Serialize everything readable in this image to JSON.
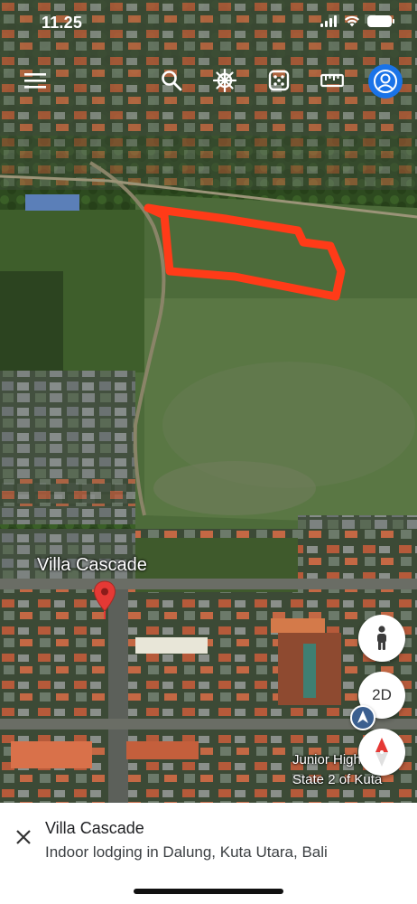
{
  "status_bar": {
    "time": "11.25"
  },
  "toolbar": {
    "menu": "menu-icon",
    "search": "search-icon",
    "voyager": "ship-wheel-icon",
    "random": "dice-icon",
    "measure": "ruler-icon",
    "profile": "profile-icon"
  },
  "map": {
    "place_label": "Villa Cascade",
    "poi_line1": "Junior High Schoo",
    "poi_line2": "State 2 of Kuta",
    "outline_color": "#ff3b18"
  },
  "controls": {
    "view_mode_label": "2D"
  },
  "place_card": {
    "title": "Villa Cascade",
    "subtitle": "Indoor lodging in Dalung, Kuta Utara, Bali"
  },
  "colors": {
    "accent": "#1a73e8",
    "pin": "#e53935"
  }
}
